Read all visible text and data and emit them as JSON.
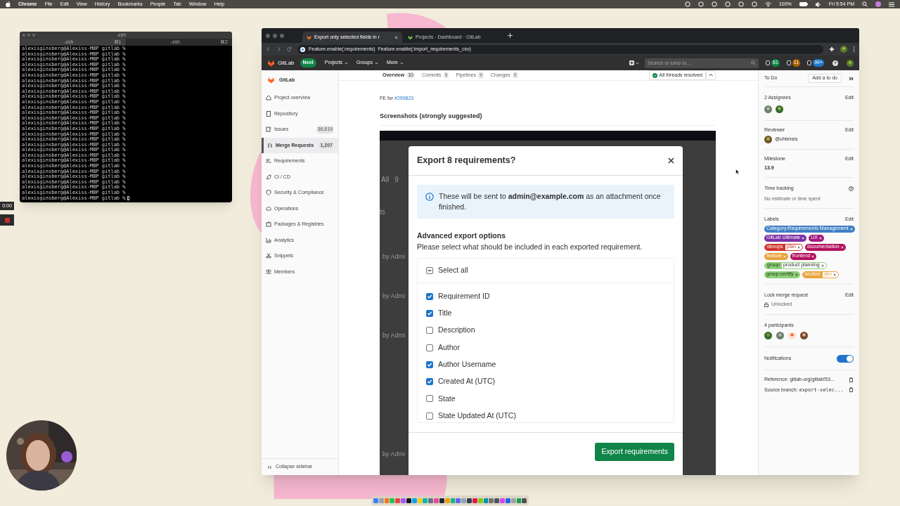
{
  "menubar": {
    "menus": [
      "Chrome",
      "File",
      "Edit",
      "View",
      "History",
      "Bookmarks",
      "People",
      "Tab",
      "Window",
      "Help"
    ],
    "battery": "100%",
    "clock": "Fri 5:54 PM"
  },
  "terminal": {
    "title": "-zsh",
    "tabs": [
      {
        "label": "-zsh",
        "shortcut": "⌘1",
        "selected": true
      },
      {
        "label": "-zsh",
        "shortcut": "⌘2",
        "selected": false
      }
    ],
    "lines": [
      "alexisginsberg@Alexiss-MBP gitlab %",
      "alexisginsberg@Alexiss-MBP gitlab %",
      "alexisginsberg@Alexiss-MBP gitlab %",
      "alexisginsberg@Alexiss-MBP gitlab %",
      "alexisginsberg@Alexiss-MBP gitlab %",
      "alexisginsberg@Alexiss-MBP gitlab %",
      "alexisginsberg@Alexiss-MBP gitlab %",
      "alexisginsberg@Alexiss-MBP gitlab %",
      "alexisginsberg@Alexiss-MBP gitlab %",
      "alexisginsberg@Alexiss-MBP gitlab %",
      "alexisginsberg@Alexiss-MBP gitlab %",
      "alexisginsberg@Alexiss-MBP gitlab %",
      "alexisginsberg@Alexiss-MBP gitlab %",
      "alexisginsberg@Alexiss-MBP gitlab %",
      "alexisginsberg@Alexiss-MBP gitlab %",
      "alexisginsberg@Alexiss-MBP gitlab %",
      "alexisginsberg@Alexiss-MBP gitlab %",
      "alexisginsberg@Alexiss-MBP gitlab %",
      "alexisginsberg@Alexiss-MBP gitlab %",
      "alexisginsberg@Alexiss-MBP gitlab %",
      "alexisginsberg@Alexiss-MBP gitlab %",
      "alexisginsberg@Alexiss-MBP gitlab %",
      "alexisginsberg@Alexiss-MBP gitlab %",
      "alexisginsberg@Alexiss-MBP gitlab %",
      "alexisginsberg@Alexiss-MBP gitlab %",
      "alexisginsberg@Alexiss-MBP gitlab %",
      "alexisginsberg@Alexiss-MBP gitlab %",
      "alexisginsberg@Alexiss-MBP gitlab %",
      "alexisginsberg@Alexiss-MBP gitlab %"
    ]
  },
  "recorder": {
    "time": "0:00"
  },
  "browser": {
    "tabs": [
      {
        "title": "Export only selected fields in r",
        "selected": true
      },
      {
        "title": "Projects · Dashboard · GitLab",
        "selected": false
      }
    ],
    "address": "Feature.enable(:requirements)  Feature.enable(:import_requirements_csv)"
  },
  "gitlab_nav": {
    "brand": "GitLab",
    "badge": "Next",
    "menus": [
      "Projects",
      "Groups",
      "More"
    ],
    "search": {
      "placeholder": "Search or jump to..."
    },
    "counters": [
      "61",
      "11",
      "99+"
    ]
  },
  "sidebar": {
    "project": "GitLab",
    "items": [
      {
        "label": "Project overview",
        "selected": false
      },
      {
        "label": "Repository",
        "selected": false
      },
      {
        "label": "Issues",
        "count": "36,619",
        "selected": false
      },
      {
        "label": "Merge Requests",
        "count": "1,207",
        "selected": true
      },
      {
        "label": "Requirements",
        "selected": false
      },
      {
        "label": "CI / CD",
        "selected": false
      },
      {
        "label": "Security & Compliance",
        "selected": false
      },
      {
        "label": "Operations",
        "selected": false
      },
      {
        "label": "Packages & Registries",
        "selected": false
      },
      {
        "label": "Analytics",
        "selected": false
      },
      {
        "label": "Snippets",
        "selected": false
      },
      {
        "label": "Members",
        "selected": false
      }
    ],
    "collapse": "Collapse sidebar"
  },
  "mr_tabs": [
    {
      "label": "Overview",
      "count": "10",
      "selected": true
    },
    {
      "label": "Commits",
      "count": "9",
      "selected": false
    },
    {
      "label": "Pipelines",
      "count": "9",
      "selected": false
    },
    {
      "label": "Changes",
      "count": "9",
      "selected": false
    }
  ],
  "threads": "All threads resolved",
  "description": {
    "fe_prefix": "FE for",
    "issue_link": "#290823",
    "heading": "Screenshots (strongly suggested)"
  },
  "embedded": {
    "tab_label": "All",
    "tab_count": "9",
    "fragment": "ts",
    "rows": [
      "by Admi",
      "by Admi",
      "by Admi",
      "by Admi"
    ],
    "modal": {
      "title": "Export 8 requirements?",
      "alert": "These will be sent to **admin@example.com** as an attachment once finished.",
      "options_title": "Advanced export options",
      "options_hint": "Please select what should be included in each exported requirement.",
      "select_all": {
        "label": "Select all",
        "checked": false,
        "indeterminate": true
      },
      "fields": [
        {
          "label": "Requirement ID",
          "checked": true
        },
        {
          "label": "Title",
          "checked": true
        },
        {
          "label": "Description",
          "checked": false
        },
        {
          "label": "Author",
          "checked": false
        },
        {
          "label": "Author Username",
          "checked": true
        },
        {
          "label": "Created At (UTC)",
          "checked": true
        },
        {
          "label": "State",
          "checked": false
        },
        {
          "label": "State Updated At (UTC)",
          "checked": false
        }
      ],
      "button": "Export requirements"
    }
  },
  "right_sidebar": {
    "todo": "To Do",
    "add_todo": "Add a to do",
    "assignees": "2 Assignees",
    "reviewer_title": "Reviewer",
    "reviewer": "@uhlexsis",
    "milestone_title": "Milestone",
    "milestone": "13.9",
    "time_title": "Time tracking",
    "time_value": "No estimate or time spent",
    "labels_title": "Labels",
    "labels": [
      {
        "text": "Category:Requirements Management",
        "color": "#3f7fc4"
      },
      {
        "text": "GitLab Ultimate",
        "color": "#7b2fa3"
      },
      {
        "text": "UX",
        "color": "#a3197e"
      },
      {
        "scope": "devops",
        "value": "plan",
        "color": "#d0312d"
      },
      {
        "text": "documentation",
        "color": "#b3125e"
      },
      {
        "text": "feature",
        "color": "#e9a23b"
      },
      {
        "text": "frontend",
        "color": "#b3125e"
      },
      {
        "scope": "group",
        "value": "product planning",
        "color": "#8fd07b"
      },
      {
        "text": "group:certify",
        "color": "#8fd07b"
      },
      {
        "scope": "section",
        "value": "dev",
        "color": "#e9a23b"
      }
    ],
    "lock_title": "Lock merge request",
    "lock_value": "Unlocked",
    "participants": "4 participants",
    "notifications": "Notifications",
    "notifications_on": true,
    "reference": "Reference: gitlab-org/gitlab!53...",
    "branch_prefix": "Source branch:",
    "branch": "export-selec...",
    "edits": [
      "Edit",
      "Edit",
      "Edit",
      "Edit",
      "Edit"
    ]
  }
}
